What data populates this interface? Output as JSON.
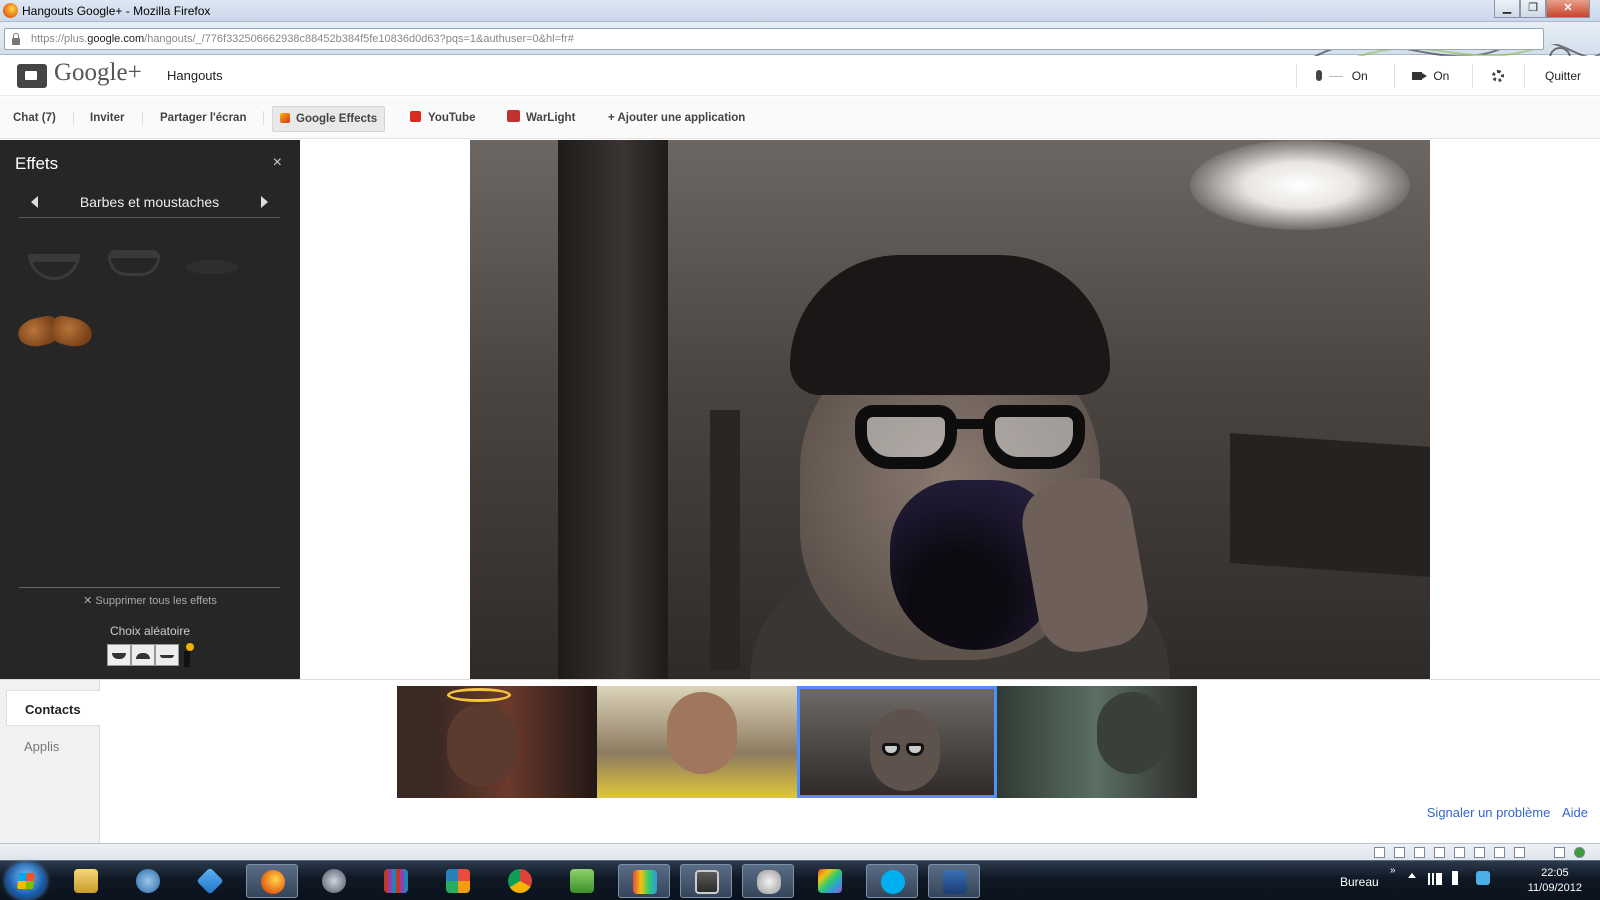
{
  "window": {
    "title": "Hangouts Google+ - Mozilla Firefox",
    "minimize_label": "▁",
    "restore_label": "❐",
    "close_label": "✕",
    "url_prefix": "https://plus.",
    "url_domain": "google.com",
    "url_rest": "/hangouts/_/776f332506662938c88452b384f5fe10836d0d63?pqs=1&authuser=0&hl=fr#"
  },
  "header": {
    "brand": "Google+",
    "app_name": "Hangouts",
    "mic_status": "On",
    "camera_status": "On",
    "quit_label": "Quitter"
  },
  "toolbar": {
    "items": [
      {
        "label": "Chat (7)"
      },
      {
        "label": "Inviter"
      },
      {
        "label": "Partager l'écran"
      },
      {
        "label": "Google Effects"
      },
      {
        "label": "YouTube"
      },
      {
        "label": "WarLight"
      },
      {
        "label": "+ Ajouter une application"
      }
    ]
  },
  "effects": {
    "title": "Effets",
    "close_label": "×",
    "category": "Barbes et moustaches",
    "remove_all_label": "✕ Supprimer tous les effets",
    "random_label": "Choix aléatoire",
    "thumbs": [
      "goatee-icon",
      "beard-icon",
      "thin-mustache-icon",
      "brown-mustache-icon"
    ]
  },
  "bottom": {
    "tabs": [
      {
        "label": "Contacts"
      },
      {
        "label": "Applis"
      }
    ],
    "report_link": "Signaler un problème",
    "help_link": "Aide"
  },
  "taskbar": {
    "tray_label": "Bureau",
    "tray_chevron": "»",
    "time": "22:05",
    "date": "11/09/2012",
    "apps": [
      "windows-explorer-icon",
      "chat-icon",
      "dropbox-icon",
      "firefox-icon",
      "steam-icon",
      "library-icon",
      "office-icon",
      "chrome-icon",
      "evernote-icon",
      "studio-icon",
      "sublime-icon",
      "game-icon",
      "palette-icon",
      "skype-icon",
      "powershell-icon"
    ]
  },
  "colors": {
    "link": "#3366cc",
    "selected_participant": "#4d90fe",
    "effects_panel": "#262626"
  }
}
